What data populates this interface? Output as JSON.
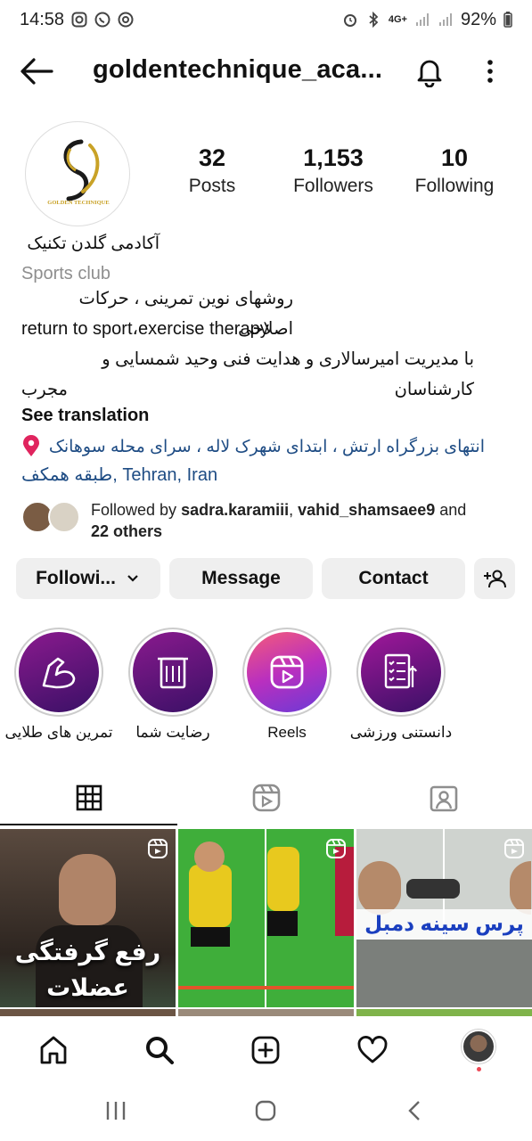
{
  "status_bar": {
    "time": "14:58",
    "battery": "92%",
    "network": "4G+"
  },
  "header": {
    "username": "goldentechnique_aca..."
  },
  "profile": {
    "logo_text": "GOLDEN TECHNIQUE",
    "stats": [
      {
        "value": "32",
        "label": "Posts"
      },
      {
        "value": "1,153",
        "label": "Followers"
      },
      {
        "value": "10",
        "label": "Following"
      }
    ],
    "name": "آکادمی گلدن تکنیک",
    "category": "Sports club",
    "bio_lines": [
      "روشهای نوین تمرینی ، حرکات اصلاحی",
      "return to sport،exercise therapy",
      "با مدیریت امیرسالاری و هدایت فنی وحید شمسایی و کارشناسان",
      "مجرب"
    ],
    "see_translation": "See translation",
    "location_line1": "انتهای بزرگراه ارتش ، ابتدای شهرک لاله ، سرای محله سوهانک",
    "location_line2_rtl": "طبقه همکف",
    "location_line2_ltr": ", Tehran, Iran",
    "followed_by_prefix": "Followed by ",
    "followed_by_user1": "sadra.karamiii",
    "followed_by_sep": ", ",
    "followed_by_user2": "vahid_shamsaee9",
    "followed_by_and": " and",
    "followed_by_others": "22 others"
  },
  "actions": {
    "following": "Followi...",
    "message": "Message",
    "contact": "Contact"
  },
  "highlights": [
    {
      "label": "تمرین های طلایی",
      "icon": "muscle-arm-icon"
    },
    {
      "label": "رضایت شما",
      "icon": "towel-icon"
    },
    {
      "label": "Reels",
      "icon": "reels-icon"
    },
    {
      "label": "دانستنی ورزشی",
      "icon": "checklist-icon"
    }
  ],
  "posts": [
    {
      "caption_line1": "رفع گرفتگی",
      "caption_line2": "عضلات"
    },
    {
      "caption_line1": ""
    },
    {
      "caption_line1": "پرس سینه دمبل"
    }
  ],
  "colors": {
    "link": "#1e4c84",
    "button_bg": "#efefef",
    "notification_dot": "#ed4956"
  }
}
